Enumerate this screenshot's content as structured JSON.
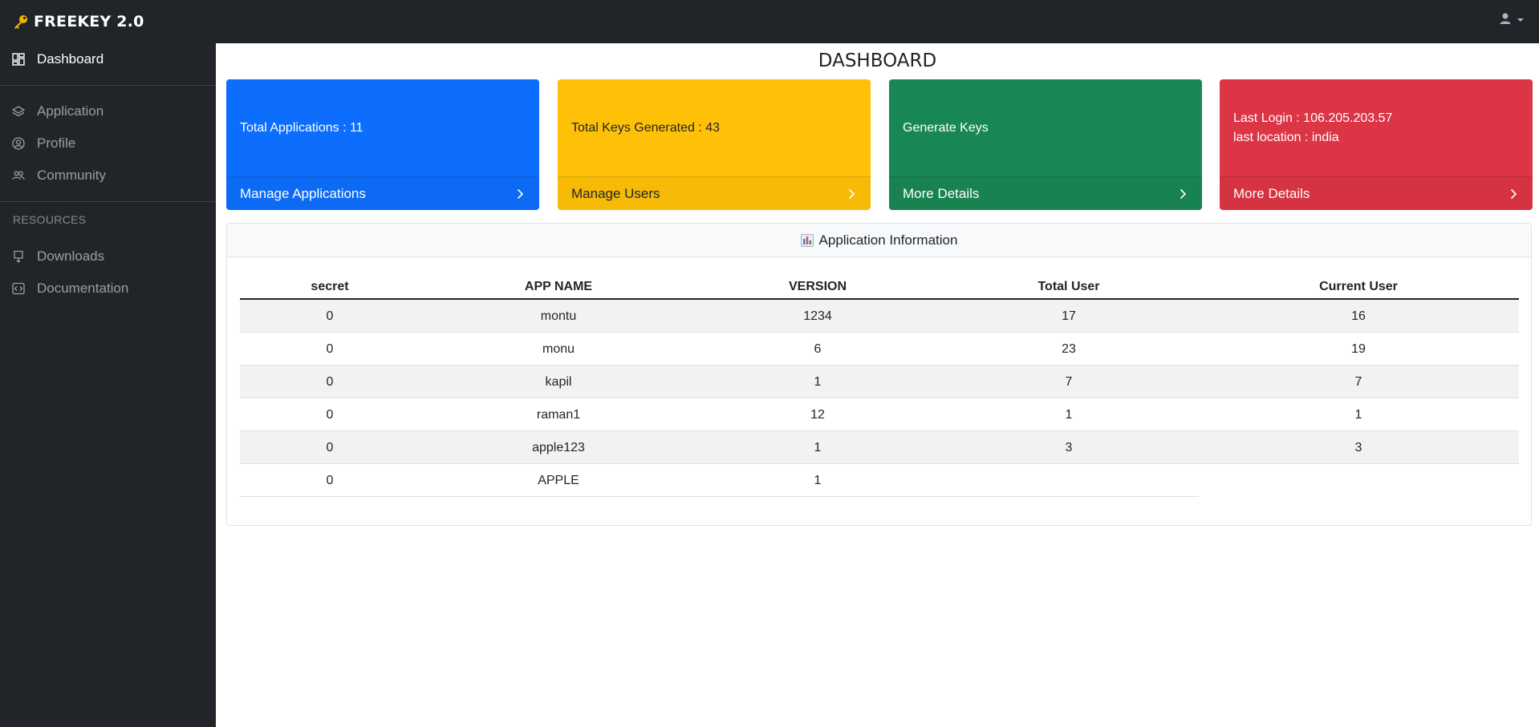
{
  "brand": {
    "title": "FREEKEY 2.0",
    "icon": "key-icon"
  },
  "sidebar": {
    "top_items": [
      {
        "label": "Dashboard",
        "icon": "dashboard-icon",
        "active": true
      }
    ],
    "items": [
      {
        "label": "Application",
        "icon": "layers-icon"
      },
      {
        "label": "Profile",
        "icon": "user-circle-icon"
      },
      {
        "label": "Community",
        "icon": "people-icon"
      }
    ],
    "resources_heading": "RESOURCES",
    "resources": [
      {
        "label": "Downloads",
        "icon": "download-icon"
      },
      {
        "label": "Documentation",
        "icon": "code-icon"
      }
    ]
  },
  "page": {
    "title": "DASHBOARD"
  },
  "cards": [
    {
      "line1": "Total Applications : 11",
      "line2": "",
      "footer": "Manage Applications",
      "color": "#0d6efd"
    },
    {
      "line1": "Total Keys Generated : 43",
      "line2": "",
      "footer": "Manage Users",
      "color": "#ffc107"
    },
    {
      "line1": "Generate Keys",
      "line2": "",
      "footer": "More Details",
      "color": "#198754"
    },
    {
      "line1": "Last Login : 106.205.203.57",
      "line2": "last location : india",
      "footer": "More Details",
      "color": "#dc3545"
    }
  ],
  "info": {
    "title": "Application Information",
    "columns": [
      "secret",
      "APP NAME",
      "VERSION",
      "Total User",
      "Current User"
    ],
    "rows": [
      [
        "0",
        "montu",
        "1234",
        "17",
        "16"
      ],
      [
        "0",
        "monu",
        "6",
        "23",
        "19"
      ],
      [
        "0",
        "kapil",
        "1",
        "7",
        "7"
      ],
      [
        "0",
        "raman1",
        "12",
        "1",
        "1"
      ],
      [
        "0",
        "apple123",
        "1",
        "3",
        "3"
      ],
      [
        "0",
        "APPLE",
        "1",
        "",
        ""
      ]
    ]
  }
}
